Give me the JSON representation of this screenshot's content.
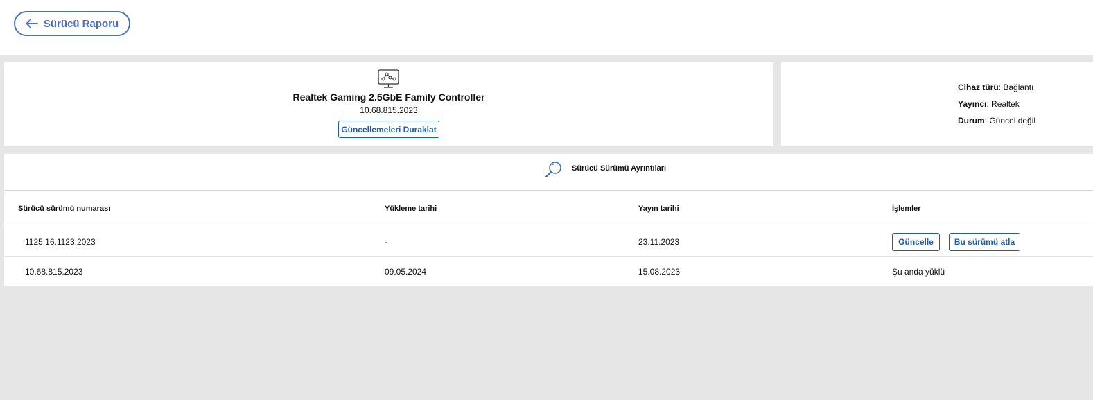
{
  "header": {
    "back_label": "Sürücü Raporu"
  },
  "driver": {
    "name": "Realtek Gaming 2.5GbE Family Controller",
    "version": "10.68.815.2023",
    "pause_label": "Güncellemeleri Duraklat",
    "icon": "network-monitor-icon"
  },
  "info": {
    "device_type_label": "Cihaz türü",
    "device_type_value": "Bağlantı",
    "publisher_label": "Yayıncı",
    "publisher_value": "Realtek",
    "status_label": "Durum",
    "status_value": "Güncel değil"
  },
  "details": {
    "title": "Sürücü Sürümü Ayrıntıları",
    "icon": "search-icon",
    "columns": [
      "Sürücü sürümü numarası",
      "Yükleme tarihi",
      "Yayın tarihi",
      "İşlemler"
    ],
    "rows": [
      {
        "version": "1125.16.1123.2023",
        "install_date": "-",
        "release_date": "23.11.2023",
        "actions": [
          "Güncelle",
          "Bu sürümü atla"
        ]
      },
      {
        "version": "10.68.815.2023",
        "install_date": "09.05.2024",
        "release_date": "15.08.2023",
        "status": "Şu anda yüklü"
      }
    ]
  },
  "colors": {
    "accent": "#1a5fa8",
    "back_button": "#4a72b8",
    "background": "#e6e6e6"
  }
}
